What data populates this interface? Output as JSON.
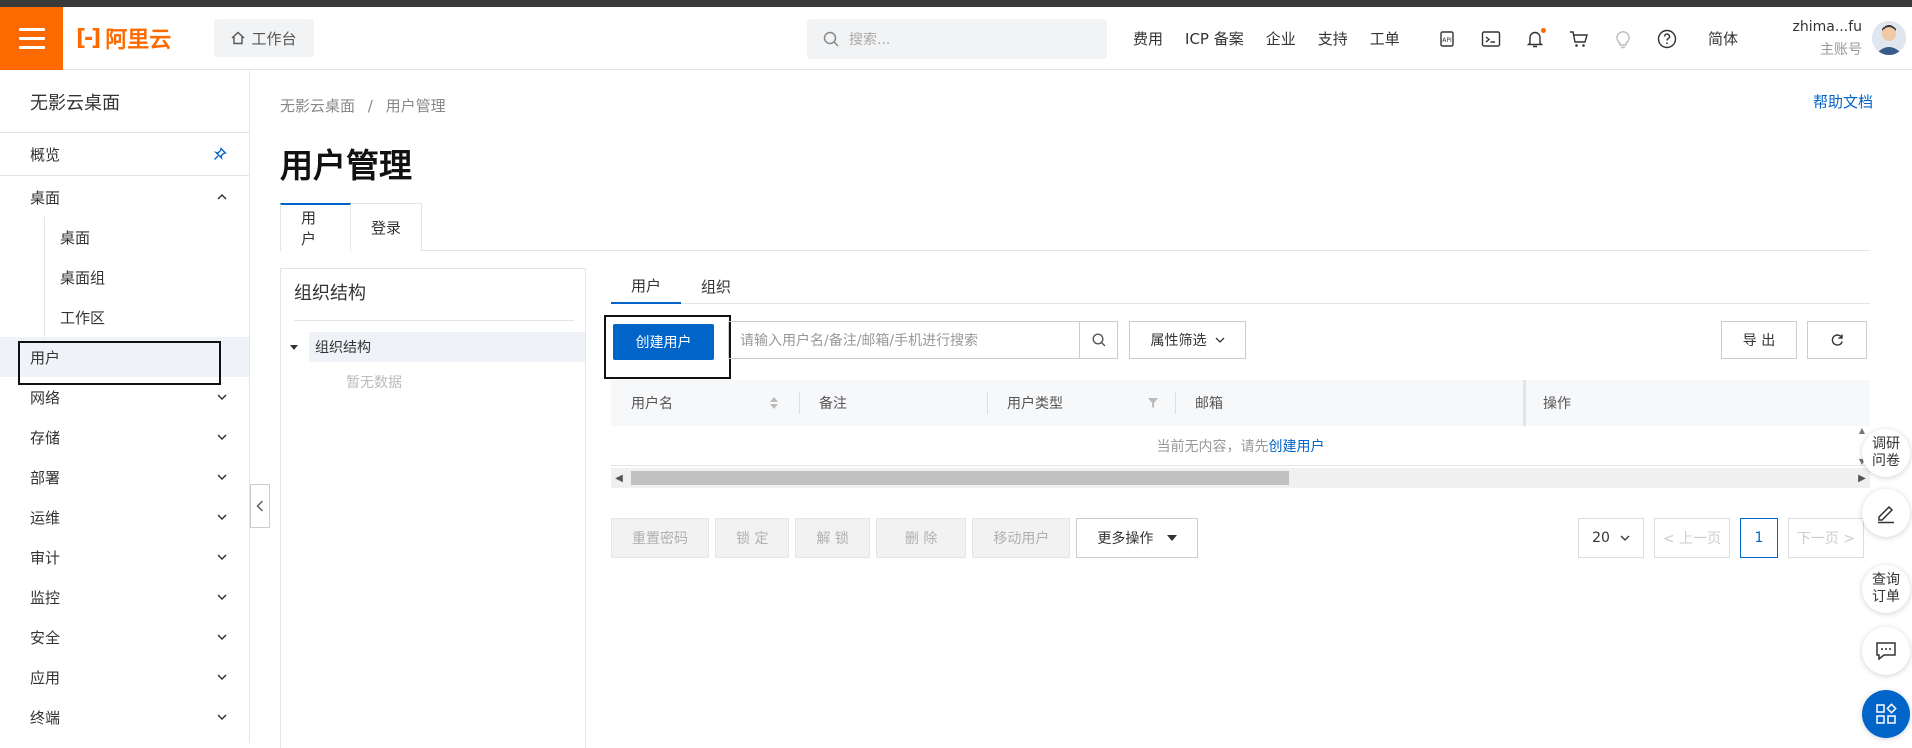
{
  "header": {
    "logo_text": "阿里云",
    "workbench_label": "工作台",
    "search_placeholder": "搜索...",
    "links": [
      "费用",
      "ICP 备案",
      "企业",
      "支持",
      "工单"
    ],
    "icons": [
      "api-icon",
      "terminal-icon",
      "bell-icon",
      "cart-icon",
      "bulb-icon",
      "help-icon"
    ],
    "language": "简体",
    "account_name": "zhima...fu",
    "account_role": "主账号",
    "accent_color": "#ff6a00"
  },
  "sidebar": {
    "title": "无影云桌面",
    "overview": "概览",
    "desktop_group": "桌面",
    "desktop_sub": [
      "桌面",
      "桌面组",
      "工作区"
    ],
    "items": [
      "用户",
      "网络",
      "存储",
      "部署",
      "运维",
      "审计",
      "监控",
      "安全",
      "应用",
      "终端"
    ],
    "selected": "用户"
  },
  "main": {
    "breadcrumb": [
      "无影云桌面",
      "用户管理"
    ],
    "breadcrumb_sep": "/",
    "help_link": "帮助文档",
    "page_title": "用户管理",
    "tabs": [
      "用户",
      "登录"
    ],
    "active_tab": "用户",
    "primary_color": "#0064c8"
  },
  "org_panel": {
    "title": "组织结构",
    "root_node": "组织结构",
    "empty_text": "暂无数据"
  },
  "user_panel": {
    "subtabs": [
      "用户",
      "组织"
    ],
    "create_button": "创建用户",
    "search_placeholder": "请输入用户名/备注/邮箱/手机进行搜索",
    "filter_button": "属性筛选",
    "export_button": "导 出",
    "columns": [
      "用户名",
      "备注",
      "用户类型",
      "邮箱",
      "操作"
    ],
    "empty_prefix": "当前无内容，请先",
    "empty_link": "创建用户",
    "batch_buttons": [
      "重置密码",
      "锁 定",
      "解 锁",
      "删 除",
      "移动用户"
    ],
    "more_actions": "更多操作",
    "page_size": "20",
    "prev_page": "< 上一页",
    "current_page": "1",
    "next_page": "下一页 >"
  },
  "floating": {
    "survey": [
      "调研",
      "问卷"
    ],
    "orders": [
      "查询",
      "订单"
    ]
  }
}
